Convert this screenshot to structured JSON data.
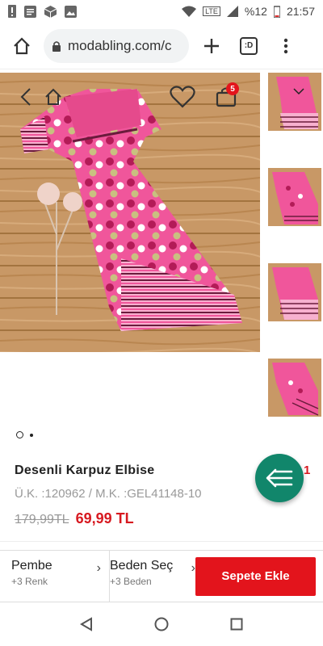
{
  "status_bar": {
    "battery_text": "%12",
    "time": "21:57",
    "network": "LTE"
  },
  "browser": {
    "url": "modabling.com/c",
    "tab_count": ":D"
  },
  "product": {
    "cart_badge_count": "5",
    "title": "Desenli Karpuz Elbise",
    "codes": "Ü.K. :120962 / M.K. :GEL41148-10",
    "old_price": "179,99TL",
    "new_price": "69,99 TL",
    "fab_badge": "1"
  },
  "actions": {
    "color_label": "Pembe",
    "color_sub": "+3 Renk",
    "size_label": "Beden Seç",
    "size_sub": "+3 Beden",
    "add_to_cart": "Sepete Ekle"
  },
  "colors": {
    "accent_red": "#e3141c",
    "price_red": "#d71920",
    "fab_green": "#11866b",
    "dress_pink": "#f0569b"
  }
}
